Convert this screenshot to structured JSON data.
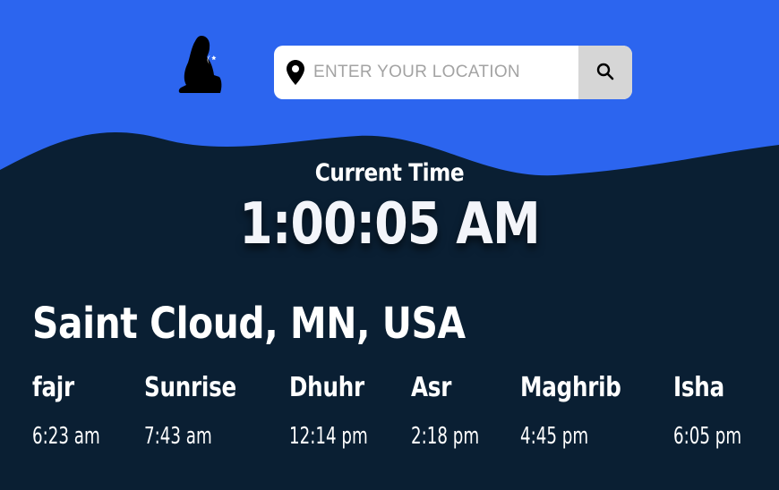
{
  "colors": {
    "sky": "#2c65ef",
    "background": "#0a1f33",
    "search_button": "#d6d6d6"
  },
  "header": {
    "logo_icon": "praying-person-icon",
    "search": {
      "placeholder": "ENTER YOUR LOCATION",
      "value": "",
      "pin_icon": "map-pin-icon",
      "button_icon": "search-icon"
    }
  },
  "clock": {
    "label": "Current Time",
    "time": "1:00:05 AM"
  },
  "location": {
    "city": "Saint Cloud, MN, USA"
  },
  "prayers": [
    {
      "name": "fajr",
      "time": "6:23 am"
    },
    {
      "name": "Sunrise",
      "time": "7:43 am"
    },
    {
      "name": "Dhuhr",
      "time": "12:14 pm"
    },
    {
      "name": "Asr",
      "time": "2:18 pm"
    },
    {
      "name": "Maghrib",
      "time": "4:45 pm"
    },
    {
      "name": "Isha",
      "time": "6:05 pm"
    }
  ]
}
